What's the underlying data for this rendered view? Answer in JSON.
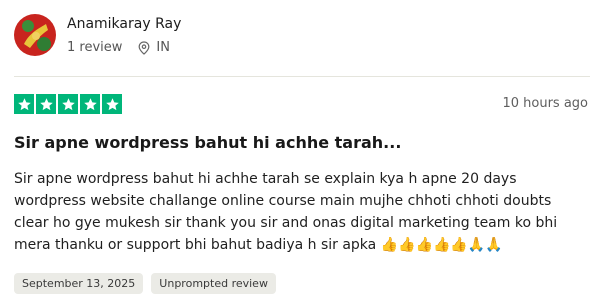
{
  "reviewer": {
    "name": "Anamikaray Ray",
    "reviews_count": "1 review",
    "country": "IN"
  },
  "review": {
    "rating": 5,
    "time_ago": "10 hours ago",
    "title": "Sir apne wordpress bahut hi achhe tarah...",
    "body": "Sir apne wordpress bahut hi achhe tarah se explain kya h apne 20 days wordpress website challange online course main mujhe chhoti chhoti doubts clear ho gye mukesh sir thank you sir and onas digital marketing team ko bhi mera thanku or support bhi bahut badiya h sir apka 👍👍👍👍👍🙏🙏",
    "date_tag": "September 13, 2025",
    "status_tag": "Unprompted review"
  },
  "colors": {
    "star_green": "#00b67a",
    "tag_bg": "#ebebe6"
  },
  "icons": {
    "location": "location-pin-icon",
    "star": "star-icon"
  }
}
